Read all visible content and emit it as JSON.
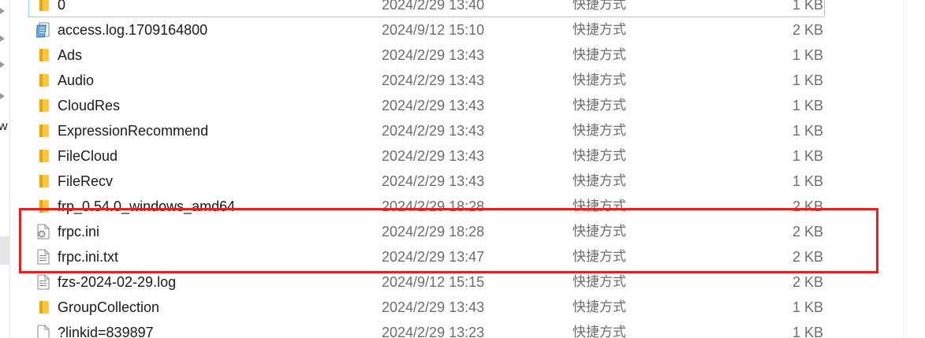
{
  "files": [
    {
      "name": "0",
      "date": "2024/2/29 13:40",
      "type": "快捷方式",
      "size": "1 KB",
      "icon": "folder-icon"
    },
    {
      "name": "access.log.1709164800",
      "date": "2024/9/12 15:10",
      "type": "快捷方式",
      "size": "2 KB",
      "icon": "log-file-icon"
    },
    {
      "name": "Ads",
      "date": "2024/2/29 13:43",
      "type": "快捷方式",
      "size": "1 KB",
      "icon": "folder-icon"
    },
    {
      "name": "Audio",
      "date": "2024/2/29 13:43",
      "type": "快捷方式",
      "size": "1 KB",
      "icon": "folder-icon"
    },
    {
      "name": "CloudRes",
      "date": "2024/2/29 13:43",
      "type": "快捷方式",
      "size": "1 KB",
      "icon": "folder-icon"
    },
    {
      "name": "ExpressionRecommend",
      "date": "2024/2/29 13:43",
      "type": "快捷方式",
      "size": "1 KB",
      "icon": "folder-icon"
    },
    {
      "name": "FileCloud",
      "date": "2024/2/29 13:43",
      "type": "快捷方式",
      "size": "1 KB",
      "icon": "folder-icon"
    },
    {
      "name": "FileRecv",
      "date": "2024/2/29 13:43",
      "type": "快捷方式",
      "size": "1 KB",
      "icon": "folder-icon"
    },
    {
      "name": "frp_0.54.0_windows_amd64",
      "date": "2024/2/29 18:28",
      "type": "快捷方式",
      "size": "2 KB",
      "icon": "folder-icon"
    },
    {
      "name": "frpc.ini",
      "date": "2024/2/29 18:28",
      "type": "快捷方式",
      "size": "2 KB",
      "icon": "settings-file-icon"
    },
    {
      "name": "frpc.ini.txt",
      "date": "2024/2/29 13:47",
      "type": "快捷方式",
      "size": "2 KB",
      "icon": "text-file-icon"
    },
    {
      "name": "fzs-2024-02-29.log",
      "date": "2024/9/12 15:15",
      "type": "快捷方式",
      "size": "2 KB",
      "icon": "text-file-icon"
    },
    {
      "name": "GroupCollection",
      "date": "2024/2/29 13:43",
      "type": "快捷方式",
      "size": "1 KB",
      "icon": "folder-icon"
    },
    {
      "name": "?linkid=839897",
      "date": "2024/2/29 13:23",
      "type": "快捷方式",
      "size": "1 KB",
      "icon": "blank-file-icon"
    }
  ],
  "nav": {
    "partial_label": "w"
  },
  "colors": {
    "folder": "#ffc83d",
    "highlight": "#e8201d",
    "focus_outline": "#99d1ff"
  }
}
